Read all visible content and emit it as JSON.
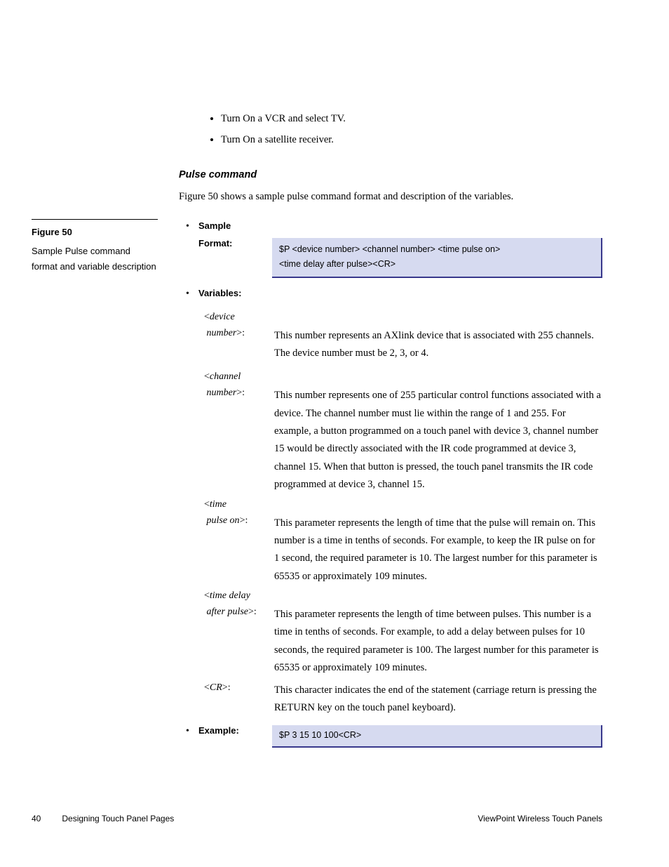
{
  "topBullets": [
    "Turn On a VCR and select TV.",
    "Turn On a satellite receiver."
  ],
  "sectionHeading": "Pulse command",
  "introPara": "Figure 50 shows a sample pulse command format and description of the variables.",
  "sidebar": {
    "title": "Figure 50",
    "text": "Sample Pulse command format and variable description"
  },
  "sample": {
    "label": "Sample",
    "formatLabel": "Format:",
    "formatLine1": "$P <device number> <channel number> <time pulse on>",
    "formatLine2": "<time delay after pulse><CR>"
  },
  "variablesLabel": "Variables:",
  "variables": [
    {
      "nameLine1": "<device",
      "nameLine2": " number>:",
      "desc": "This number represents an AXlink device that is associated with 255 channels. The device number must be 2, 3, or 4."
    },
    {
      "nameLine1": "<channel",
      "nameLine2": " number>:",
      "desc": "This number represents one of 255 particular control functions associated with a device. The channel number must lie within the range of 1 and 255. For example, a button programmed on a touch panel with device 3, channel number 15 would be directly associated with the IR code programmed at device 3, channel 15. When that button is pressed, the touch panel transmits the IR code programmed at device 3, channel 15."
    },
    {
      "nameLine1": "<time",
      "nameLine2": " pulse on>:",
      "desc": "This parameter represents the length of time that the pulse will remain on. This number is a time in tenths of seconds. For example, to keep the IR pulse on for 1 second, the required parameter is 10. The largest number for this parameter is 65535 or approximately 109 minutes."
    },
    {
      "nameLine1": "<time delay",
      "nameLine2": " after pulse>:",
      "desc": "This parameter represents the length of time between pulses. This number is a time in tenths of seconds. For example, to add a delay between pulses for 10 seconds, the required parameter is 100. The largest number for this parameter is 65535 or approximately 109 minutes."
    },
    {
      "nameLine1": "<CR>:",
      "nameLine2": "",
      "desc": "This character indicates the end of the statement (carriage return is pressing the RETURN key on the touch panel keyboard)."
    }
  ],
  "example": {
    "label": "Example:",
    "text": "$P 3 15 10 100<CR>"
  },
  "footer": {
    "pageNum": "40",
    "leftText": "Designing Touch Panel Pages",
    "rightText": "ViewPoint Wireless Touch Panels"
  }
}
